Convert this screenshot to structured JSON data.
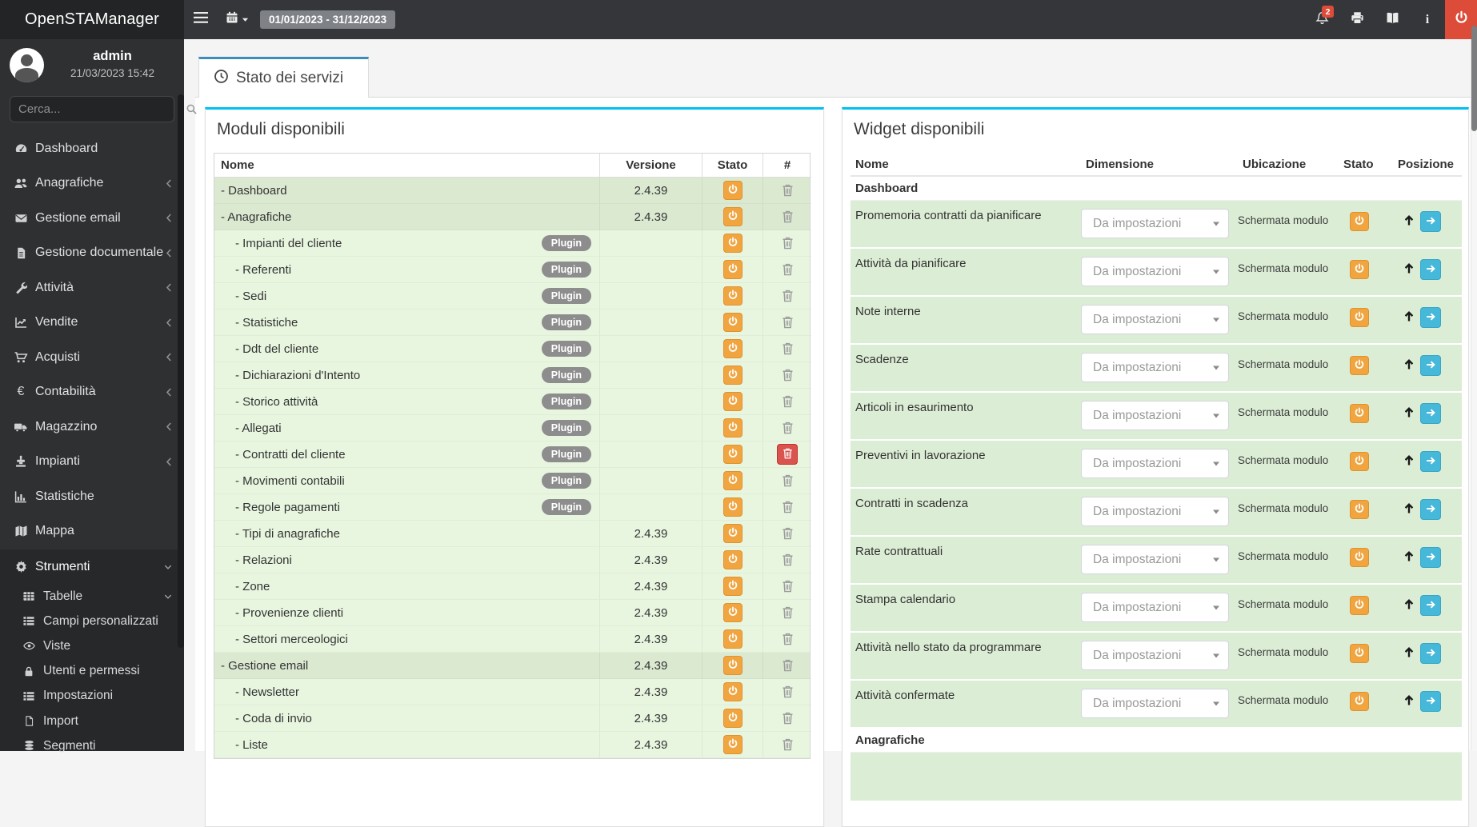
{
  "topbar": {
    "brand": "OpenSTAManager",
    "date_range": "01/01/2023 - 31/12/2023",
    "notifications_badge": "2",
    "info_glyph": "i"
  },
  "sidebar": {
    "user": {
      "name": "admin",
      "datetime": "21/03/2023 15:42"
    },
    "search_placeholder": "Cerca...",
    "items": [
      {
        "label": "Dashboard",
        "icon": "tachometer",
        "chevron": "none"
      },
      {
        "label": "Anagrafiche",
        "icon": "users",
        "chevron": "left"
      },
      {
        "label": "Gestione email",
        "icon": "envelope",
        "chevron": "left"
      },
      {
        "label": "Gestione documentale",
        "icon": "file-text",
        "chevron": "left"
      },
      {
        "label": "Attività",
        "icon": "wrench",
        "chevron": "left"
      },
      {
        "label": "Vendite",
        "icon": "chart-line",
        "chevron": "left"
      },
      {
        "label": "Acquisti",
        "icon": "cart",
        "chevron": "left"
      },
      {
        "label": "Contabilità",
        "icon": "euro",
        "chevron": "left"
      },
      {
        "label": "Magazzino",
        "icon": "truck",
        "chevron": "left"
      },
      {
        "label": "Impianti",
        "icon": "machine",
        "chevron": "left"
      },
      {
        "label": "Statistiche",
        "icon": "chart-bar",
        "chevron": "none"
      },
      {
        "label": "Mappa",
        "icon": "map",
        "chevron": "none"
      }
    ],
    "tools": {
      "label": "Strumenti",
      "icon": "gear",
      "chevron": "down",
      "items": [
        {
          "label": "Tabelle",
          "icon": "table",
          "chevron": "down"
        },
        {
          "label": "Campi personalizzati",
          "icon": "th-list",
          "chevron": "none"
        },
        {
          "label": "Viste",
          "icon": "eye",
          "chevron": "none"
        },
        {
          "label": "Utenti e permessi",
          "icon": "lock",
          "chevron": "none"
        },
        {
          "label": "Impostazioni",
          "icon": "th-list",
          "chevron": "none"
        },
        {
          "label": "Import",
          "icon": "file",
          "chevron": "none"
        },
        {
          "label": "Segmenti",
          "icon": "database",
          "chevron": "none"
        }
      ]
    }
  },
  "tab": {
    "label": "Stato dei servizi"
  },
  "modules_panel": {
    "title": "Moduli disponibili",
    "columns": [
      "Nome",
      "Versione",
      "Stato",
      "#"
    ],
    "plugin_badge": "Plugin",
    "rows": [
      {
        "name": "- Dashboard",
        "indent": false,
        "version": "2.4.39",
        "plugin": false,
        "danger": false
      },
      {
        "name": "- Anagrafiche",
        "indent": false,
        "version": "2.4.39",
        "plugin": false,
        "danger": false
      },
      {
        "name": "- Impianti del cliente",
        "indent": true,
        "version": "",
        "plugin": true,
        "danger": false
      },
      {
        "name": "- Referenti",
        "indent": true,
        "version": "",
        "plugin": true,
        "danger": false
      },
      {
        "name": "- Sedi",
        "indent": true,
        "version": "",
        "plugin": true,
        "danger": false
      },
      {
        "name": "- Statistiche",
        "indent": true,
        "version": "",
        "plugin": true,
        "danger": false
      },
      {
        "name": "- Ddt del cliente",
        "indent": true,
        "version": "",
        "plugin": true,
        "danger": false
      },
      {
        "name": "- Dichiarazioni d'Intento",
        "indent": true,
        "version": "",
        "plugin": true,
        "danger": false
      },
      {
        "name": "- Storico attività",
        "indent": true,
        "version": "",
        "plugin": true,
        "danger": false
      },
      {
        "name": "- Allegati",
        "indent": true,
        "version": "",
        "plugin": true,
        "danger": false
      },
      {
        "name": "- Contratti del cliente",
        "indent": true,
        "version": "",
        "plugin": true,
        "danger": true
      },
      {
        "name": "- Movimenti contabili",
        "indent": true,
        "version": "",
        "plugin": true,
        "danger": false
      },
      {
        "name": "- Regole pagamenti",
        "indent": true,
        "version": "",
        "plugin": true,
        "danger": false
      },
      {
        "name": "- Tipi di anagrafiche",
        "indent": true,
        "version": "2.4.39",
        "plugin": false,
        "danger": false
      },
      {
        "name": "- Relazioni",
        "indent": true,
        "version": "2.4.39",
        "plugin": false,
        "danger": false
      },
      {
        "name": "- Zone",
        "indent": true,
        "version": "2.4.39",
        "plugin": false,
        "danger": false
      },
      {
        "name": "- Provenienze clienti",
        "indent": true,
        "version": "2.4.39",
        "plugin": false,
        "danger": false
      },
      {
        "name": "- Settori merceologici",
        "indent": true,
        "version": "2.4.39",
        "plugin": false,
        "danger": false
      },
      {
        "name": "- Gestione email",
        "indent": false,
        "version": "2.4.39",
        "plugin": false,
        "danger": false
      },
      {
        "name": "- Newsletter",
        "indent": true,
        "version": "2.4.39",
        "plugin": false,
        "danger": false
      },
      {
        "name": "- Coda di invio",
        "indent": true,
        "version": "2.4.39",
        "plugin": false,
        "danger": false
      },
      {
        "name": "- Liste",
        "indent": true,
        "version": "2.4.39",
        "plugin": false,
        "danger": false
      }
    ]
  },
  "widgets_panel": {
    "title": "Widget disponibili",
    "columns": [
      "Nome",
      "Dimensione",
      "Ubicazione",
      "Stato",
      "Posizione"
    ],
    "dimension_placeholder": "Da impostazioni",
    "location": "Schermata modulo",
    "sections": [
      {
        "name": "Dashboard",
        "widgets": [
          "Promemoria contratti da pianificare",
          "Attività da pianificare",
          "Note interne",
          "Scadenze",
          "Articoli in esaurimento",
          "Preventivi in lavorazione",
          "Contratti in scadenza",
          "Rate contrattuali",
          "Stampa calendario",
          "Attività nello stato da programmare",
          "Attività confermate"
        ]
      },
      {
        "name": "Anagrafiche",
        "widgets": []
      }
    ]
  },
  "colors": {
    "tab_accent": "#3c8dbc",
    "card_accent": "#00c0ef",
    "warning_button": "#f0a541",
    "danger_button": "#d9534f",
    "info_button": "#46b8da",
    "topbar_power": "#dd4b39",
    "row_green_dark": "#dbe9d1",
    "row_green_light": "#e8f6e0",
    "widget_row_green": "#dcedd5",
    "plugin_badge_bg": "#8d8d8d"
  }
}
